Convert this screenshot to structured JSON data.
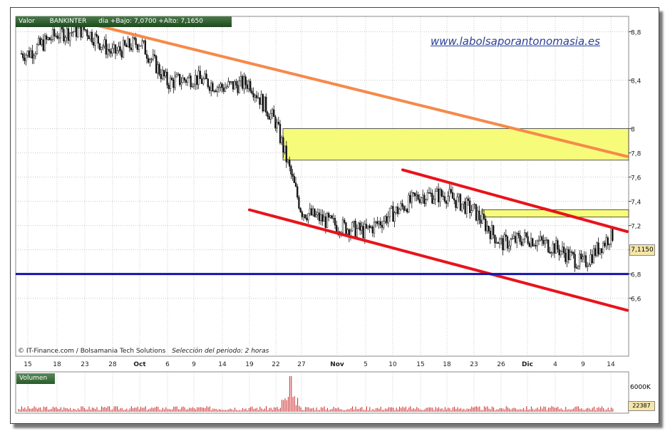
{
  "header": {
    "label": "Valor",
    "ticker": "BANKINTER",
    "info": "dia +Bajo: 7,0700 +Alto: 7,1650"
  },
  "watermark": "www.labolsaporantonomasia.es",
  "credit": "© IT-Finance.com / Bolsamania Tech Solutions",
  "period": "Selección del periodo: 2 horas",
  "last_price": "7,1150",
  "volume_label": "Volumen",
  "volume_tick": "6000K",
  "last_volume": "22387",
  "colors": {
    "resistance_orange": "#f58a4a",
    "channel_red": "#e8131b",
    "support_blue": "#1414a8",
    "zone_yellow": "#f7fb7a",
    "candle_up": "#ffffff",
    "candle_down": "#1a1a1a",
    "volume_bar": "#cc2222"
  },
  "chart_data": {
    "type": "line",
    "title": "BANKINTER",
    "x_tick_labels": [
      "15",
      "18",
      "23",
      "28",
      "Oct",
      "6",
      "9",
      "14",
      "19",
      "22",
      "27",
      "Nov",
      "5",
      "10",
      "15",
      "18",
      "23",
      "26",
      "Dic",
      "4",
      "9",
      "14"
    ],
    "y_ticks": [
      8.8,
      8.4,
      8,
      7.8,
      7.6,
      7.4,
      7.2,
      7,
      6.8,
      6.6
    ],
    "y_tick_labels": [
      "8,8",
      "8,4",
      "8",
      "7,8",
      "7,6",
      "7,4",
      "7,2",
      "7",
      "6,8",
      "6,6"
    ],
    "ylim": [
      6.5,
      8.9
    ],
    "approx_close_path": [
      {
        "x": "15",
        "y": 8.62
      },
      {
        "x": "18",
        "y": 8.78
      },
      {
        "x": "23",
        "y": 8.82
      },
      {
        "x": "28",
        "y": 8.62
      },
      {
        "x": "Oct",
        "y": 8.72
      },
      {
        "x": "6",
        "y": 8.38
      },
      {
        "x": "9",
        "y": 8.42
      },
      {
        "x": "14",
        "y": 8.34
      },
      {
        "x": "19",
        "y": 8.38
      },
      {
        "x": "22",
        "y": 8.05
      },
      {
        "x": "27",
        "y": 7.32
      },
      {
        "x": "Nov",
        "y": 7.2
      },
      {
        "x": "5",
        "y": 7.15
      },
      {
        "x": "10",
        "y": 7.3
      },
      {
        "x": "15",
        "y": 7.45
      },
      {
        "x": "18",
        "y": 7.45
      },
      {
        "x": "23",
        "y": 7.32
      },
      {
        "x": "26",
        "y": 7.05
      },
      {
        "x": "Dic",
        "y": 7.1
      },
      {
        "x": "4",
        "y": 7.02
      },
      {
        "x": "9",
        "y": 6.88
      },
      {
        "x": "14",
        "y": 7.12
      }
    ],
    "last_value": 7.115,
    "support_level": 6.8,
    "resistance_zones": [
      {
        "low": 7.74,
        "high": 8.0
      },
      {
        "low": 7.27,
        "high": 7.33
      }
    ],
    "trendlines": [
      {
        "name": "resistance",
        "color": "#f58a4a",
        "from": {
          "x": "23",
          "y": 8.88
        },
        "to": {
          "x": "14",
          "y": 7.77
        }
      },
      {
        "name": "channel-upper",
        "color": "#e8131b",
        "from": {
          "x": "10",
          "y": 7.66
        },
        "to": {
          "x": "14",
          "y": 7.15
        }
      },
      {
        "name": "channel-lower",
        "color": "#e8131b",
        "from": {
          "x": "19",
          "y": 7.33
        },
        "to": {
          "x": "14",
          "y": 6.5
        }
      }
    ],
    "volume_axis_label": "6000K",
    "grid": true
  }
}
